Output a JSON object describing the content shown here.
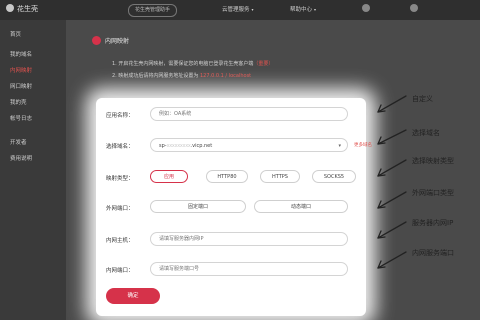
{
  "topbar": {
    "logo_text": "花生壳",
    "pill_text": "花生壳管理助手",
    "nav": [
      "云管理服务",
      "帮助中心"
    ],
    "icons": [
      "bell-icon",
      "user-icon"
    ]
  },
  "sidebar": {
    "items": [
      {
        "label": "首页",
        "active": false
      },
      {
        "label": "我的域名",
        "active": false
      },
      {
        "label": "内网映射",
        "active": true
      },
      {
        "label": "网口映射",
        "active": false
      },
      {
        "label": "我的壳",
        "active": false
      },
      {
        "label": "帐号日志",
        "active": false
      },
      {
        "label": "开发者",
        "active": false
      },
      {
        "label": "费用说明",
        "active": false
      }
    ]
  },
  "page": {
    "title": "内网映射",
    "notes": [
      {
        "prefix": "1.",
        "text": "开启花生壳内网映射，需要保证您的电脑已登录花生壳客户端",
        "highlight": "（重要）"
      },
      {
        "prefix": "2.",
        "text": "映射成功后请将内网服务地址设置为",
        "highlight": "127.0.0.1 / localhost"
      }
    ]
  },
  "form": {
    "app_name": {
      "label": "应用名称：",
      "placeholder": "例如：OA系统"
    },
    "domain": {
      "label": "选择域名：",
      "value_prefix": "sp-",
      "value_suffix": ".vicp.net",
      "overflow_note": "更多域名"
    },
    "mapping_type": {
      "label": "映射类型：",
      "options": [
        "应用",
        "HTTP80",
        "HTTPS",
        "SOCKS5"
      ],
      "selected": "应用"
    },
    "external_port": {
      "label": "外网端口：",
      "options": [
        "固定端口",
        "动态端口"
      ]
    },
    "internal_host": {
      "label": "内网主机：",
      "placeholder": "请填写服务器内网IP"
    },
    "internal_port": {
      "label": "内网端口：",
      "placeholder": "请填写服务端口号"
    },
    "submit_label": "确定"
  },
  "callouts": [
    "自定义",
    "选择域名",
    "选择映射类型",
    "外网端口类型",
    "服务器内网IP",
    "内网服务端口"
  ],
  "colors": {
    "accent": "#d6324a",
    "sidebar": "#3a3a3a",
    "topbar": "#2f2f2f",
    "overlay": "#4a4a4a"
  }
}
